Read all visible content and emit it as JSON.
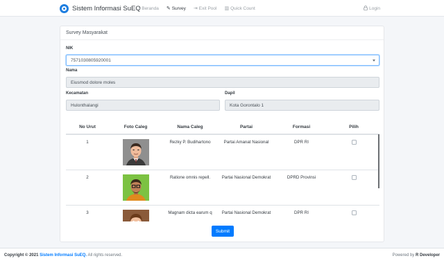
{
  "navbar": {
    "brand": "Sistem Informasi SuEQ",
    "items": [
      {
        "label": "Beranda",
        "icon": "home-icon",
        "glyph": "⌂"
      },
      {
        "label": "Survey",
        "icon": "edit-icon",
        "glyph": "✎"
      },
      {
        "label": "Exit Pool",
        "icon": "exit-icon",
        "glyph": "⇥"
      },
      {
        "label": "Quick Count",
        "icon": "bar-chart-icon",
        "glyph": "▥"
      }
    ],
    "login": {
      "label": "Login",
      "icon": "lock-icon",
      "glyph": "🔒"
    }
  },
  "card": {
    "title": "Survey Masyarakat",
    "nik": {
      "label": "NIK",
      "value": "7571030805920001"
    },
    "nama": {
      "label": "Nama",
      "value": "Eiusmod dolore moles"
    },
    "kecamatan": {
      "label": "Kecamatan",
      "value": "Hulonthalangi"
    },
    "dapil": {
      "label": "Dapil",
      "value": "Kota Gorontalo 1"
    },
    "table": {
      "headers": [
        "No Urut",
        "Foto Caleg",
        "Nama Caleg",
        "Partai",
        "Formasi",
        "Pilih"
      ],
      "rows": [
        {
          "no": "1",
          "nama": "Rezky P. Budihartono",
          "partai": "Partai Amanat Nasional",
          "formasi": "DPR RI"
        },
        {
          "no": "2",
          "nama": "Ratione omnis repell.",
          "partai": "Partai Nasional Demokrat",
          "formasi": "DPRD Provinsi"
        },
        {
          "no": "3",
          "nama": "Magnam dicta earum q",
          "partai": "Partai Nasional Demokrat",
          "formasi": "DPR RI"
        }
      ]
    },
    "submit_label": "Submit"
  },
  "footer": {
    "copy_prefix": "Copyright © 2021",
    "copy_brand": "Sistem Informasi SuEQ.",
    "copy_suffix": "All rights reserved.",
    "powered_prefix": "Powered by",
    "powered_name": "R Developer"
  },
  "colors": {
    "accent": "#007bff",
    "brand_logo": "#1e7ee0",
    "page_bg": "#f4f6f9"
  }
}
